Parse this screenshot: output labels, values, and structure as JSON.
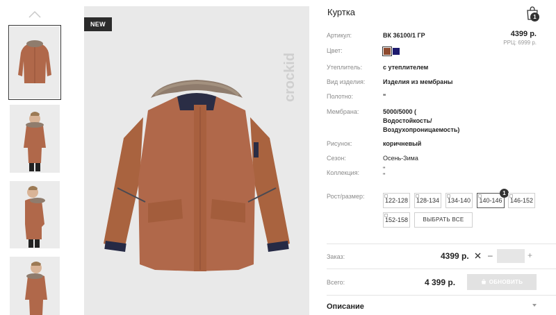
{
  "thumbnails": [
    {
      "alt": "jacket-front",
      "active": true
    },
    {
      "alt": "model-front",
      "active": false
    },
    {
      "alt": "model-side",
      "active": false
    },
    {
      "alt": "model-back",
      "active": false
    }
  ],
  "main_image": {
    "badge": "NEW",
    "brand_logo": "crockid",
    "jacket_color": "#b0684a"
  },
  "product": {
    "title": "Куртка",
    "price": "4399 р.",
    "rrp": "РРЦ: 6999 р.",
    "cart_count": "1",
    "specs": [
      {
        "label": "Артикул:",
        "value": "ВК 36100/1 ГР"
      },
      {
        "label": "Цвет:",
        "value": ""
      },
      {
        "label": "Утеплитель:",
        "value": "с утеплителем"
      },
      {
        "label": "Вид изделия:",
        "value": "Изделия из мембраны"
      },
      {
        "label": "Полотно:",
        "value": "\""
      },
      {
        "label": "Мембрана:",
        "value": "5000/5000 (\nВодостойкость/\nВоздухопроницаемость)"
      },
      {
        "label": "Рисунок:",
        "value": "коричневый"
      },
      {
        "label": "Сезон:",
        "value": "Осень-Зима"
      },
      {
        "label": "Коллекция:",
        "value": "\"\n\""
      }
    ],
    "colors": [
      {
        "name": "brown",
        "hex": "#8e4a2e",
        "selected": true
      },
      {
        "name": "navy",
        "hex": "#1d1a6e",
        "selected": false
      }
    ]
  },
  "sizes": {
    "label": "Рост/размер:",
    "options": [
      "122-128",
      "128-134",
      "134-140",
      "140-146",
      "146-152",
      "152-158"
    ],
    "selected": "140-146",
    "selected_count": "1",
    "select_all": "ВЫБРАТЬ ВСЕ"
  },
  "order": {
    "label": "Заказ:",
    "price": "4399 р.",
    "quantity": "",
    "minus": "–",
    "plus": "+"
  },
  "total": {
    "label": "Всего:",
    "price": "4 399 р.",
    "update_button": "ОБНОВИТЬ"
  },
  "description": {
    "label": "Описание"
  }
}
